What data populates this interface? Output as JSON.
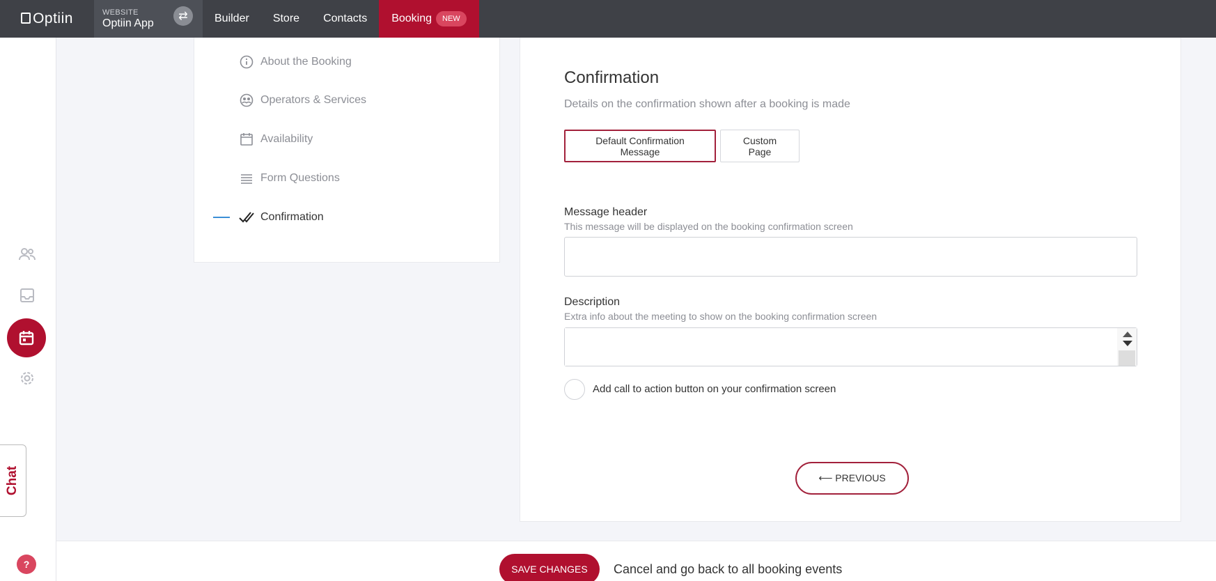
{
  "topbar": {
    "logo": "Optiin",
    "site_label": "WEBSITE",
    "site_name": "Optiin App",
    "nav": [
      "Builder",
      "Store",
      "Contacts"
    ],
    "active_nav": "Booking",
    "active_badge": "NEW",
    "accent": "#b0102f"
  },
  "rail": {
    "icons": [
      "contacts-icon",
      "inbox-icon",
      "calendar-icon",
      "gear-icon"
    ],
    "chat_label": "Chat",
    "help_label": "?"
  },
  "steps": [
    {
      "label": "About the Booking",
      "icon": "info-icon"
    },
    {
      "label": "Operators & Services",
      "icon": "operators-icon"
    },
    {
      "label": "Availability",
      "icon": "calendar-icon"
    },
    {
      "label": "Form Questions",
      "icon": "list-icon"
    },
    {
      "label": "Confirmation",
      "icon": "double-check-icon"
    }
  ],
  "main": {
    "title": "Confirmation",
    "subtitle": "Details on the confirmation shown after a booking is made",
    "options": [
      "Default Confirmation Message",
      "Custom Page"
    ],
    "selected_option": "Default Confirmation Message",
    "message_header": {
      "label": "Message header",
      "help": "This message will be displayed on the booking confirmation screen",
      "value": ""
    },
    "description": {
      "label": "Description",
      "help": "Extra info about the meeting to show on the booking confirmation screen",
      "value": ""
    },
    "cta_label": "Add call to action button on your confirmation screen",
    "previous_label": "⟵ PREVIOUS"
  },
  "footer": {
    "save_label": "SAVE CHANGES",
    "cancel_label": "Cancel and go back to all booking events"
  }
}
